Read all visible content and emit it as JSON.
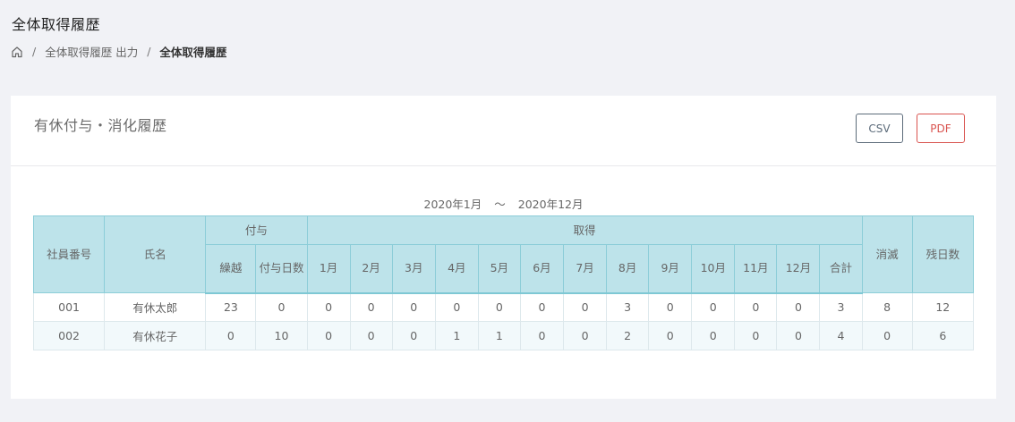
{
  "page": {
    "title": "全体取得履歴"
  },
  "breadcrumb": {
    "sep": "/",
    "parent": "全体取得履歴 出力",
    "current": "全体取得履歴"
  },
  "card": {
    "title": "有休付与・消化履歴",
    "csv_label": "CSV",
    "pdf_label": "PDF"
  },
  "period": {
    "from": "2020年1月",
    "tilde": "〜",
    "to": "2020年12月"
  },
  "table": {
    "headers": {
      "employee_no": "社員番号",
      "name": "氏名",
      "grant": "付与",
      "carryover": "繰越",
      "grant_days": "付与日数",
      "taken": "取得",
      "months": [
        "1月",
        "2月",
        "3月",
        "4月",
        "5月",
        "6月",
        "7月",
        "8月",
        "9月",
        "10月",
        "11月",
        "12月"
      ],
      "total": "合計",
      "expired": "消滅",
      "remaining": "残日数"
    },
    "rows": [
      {
        "employee_no": "001",
        "name": "有休太郎",
        "carryover": "23",
        "grant_days": "0",
        "months": [
          "0",
          "0",
          "0",
          "0",
          "0",
          "0",
          "0",
          "3",
          "0",
          "0",
          "0",
          "0"
        ],
        "total": "3",
        "expired": "8",
        "remaining": "12"
      },
      {
        "employee_no": "002",
        "name": "有休花子",
        "carryover": "0",
        "grant_days": "10",
        "months": [
          "0",
          "0",
          "0",
          "1",
          "1",
          "0",
          "0",
          "2",
          "0",
          "0",
          "0",
          "0"
        ],
        "total": "4",
        "expired": "0",
        "remaining": "6"
      }
    ]
  }
}
